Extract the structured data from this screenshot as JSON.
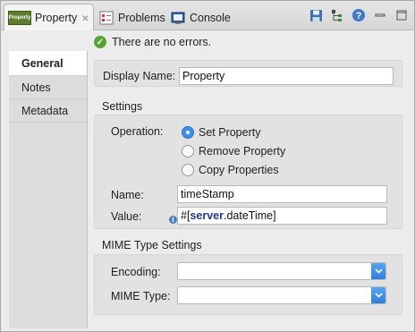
{
  "tabs": {
    "active": {
      "icon_text": "Property",
      "label": "Property"
    },
    "problems": {
      "label": "Problems"
    },
    "console": {
      "label": "Console"
    }
  },
  "toolbar": {
    "icons": [
      "save-icon",
      "tree-icon",
      "help-icon",
      "minimize-icon",
      "maximize-icon"
    ]
  },
  "status": {
    "message": "There are no errors."
  },
  "nav": {
    "items": [
      {
        "label": "General",
        "selected": true
      },
      {
        "label": "Notes",
        "selected": false
      },
      {
        "label": "Metadata",
        "selected": false
      }
    ]
  },
  "general": {
    "display_name_label": "Display Name:",
    "display_name_value": "Property"
  },
  "settings": {
    "title": "Settings",
    "operation_label": "Operation:",
    "operations": [
      {
        "label": "Set Property",
        "selected": true
      },
      {
        "label": "Remove Property",
        "selected": false
      },
      {
        "label": "Copy Properties",
        "selected": false
      }
    ],
    "name_label": "Name:",
    "name_value": "timeStamp",
    "value_label": "Value:",
    "value_prefix": "#[",
    "value_keyword": "server",
    "value_suffix": ".dateTime]"
  },
  "mime": {
    "title": "MIME Type Settings",
    "encoding_label": "Encoding:",
    "encoding_value": "",
    "mime_type_label": "MIME Type:",
    "mime_type_value": ""
  },
  "colors": {
    "accent": "#3c8ee8",
    "ok_green": "#55a630",
    "property_icon": "#5b7d2c"
  }
}
